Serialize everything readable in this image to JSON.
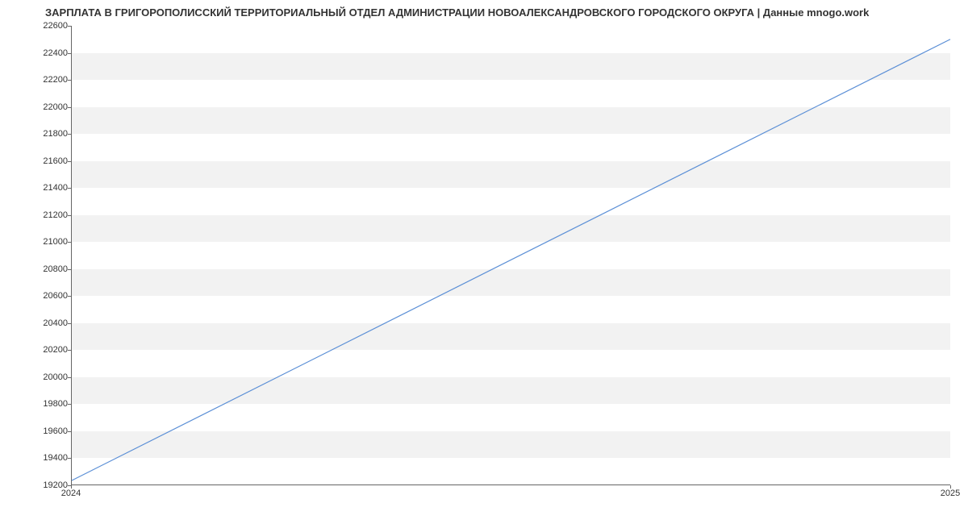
{
  "chart_data": {
    "type": "line",
    "title": "ЗАРПЛАТА В ГРИГОРОПОЛИССКИЙ ТЕРРИТОРИАЛЬНЫЙ ОТДЕЛ АДМИНИСТРАЦИИ НОВОАЛЕКСАНДРОВСКОГО ГОРОДСКОГО ОКРУГА | Данные mnogo.work",
    "xlabel": "",
    "ylabel": "",
    "x": [
      "2024",
      "2025"
    ],
    "values": [
      19230,
      22500
    ],
    "ylim": [
      19200,
      22600
    ],
    "y_ticks": [
      19200,
      19400,
      19600,
      19800,
      20000,
      20200,
      20400,
      20600,
      20800,
      21000,
      21200,
      21400,
      21600,
      21800,
      22000,
      22200,
      22400,
      22600
    ],
    "line_color": "#5b8fd6",
    "band_color": "#f2f2f2"
  }
}
